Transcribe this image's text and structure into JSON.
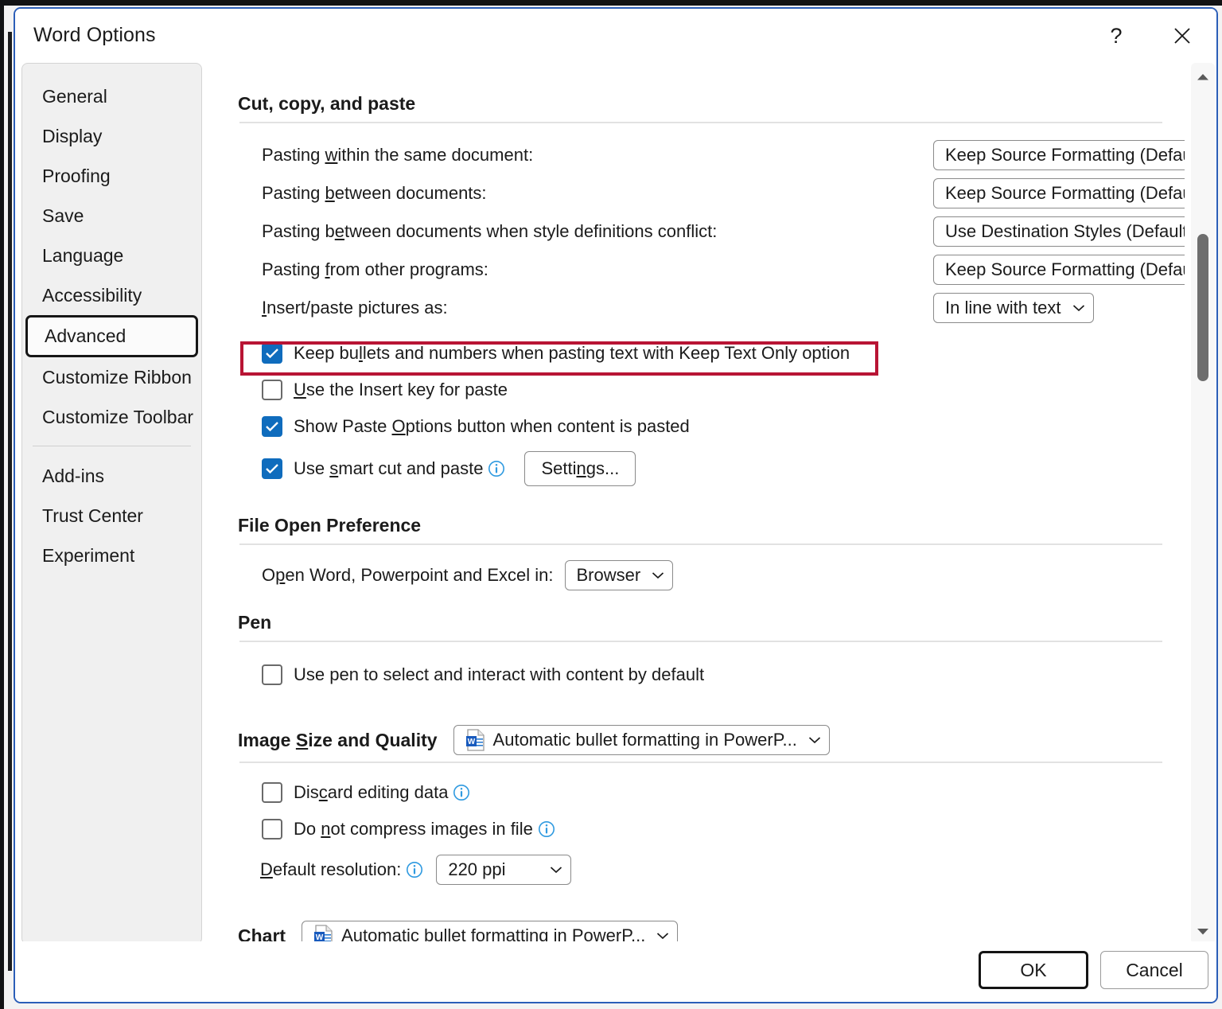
{
  "window": {
    "title": "Word Options",
    "help_icon": "question-mark-icon",
    "close_icon": "close-icon"
  },
  "sidebar": {
    "items": [
      {
        "label": "General",
        "selected": false
      },
      {
        "label": "Display",
        "selected": false
      },
      {
        "label": "Proofing",
        "selected": false
      },
      {
        "label": "Save",
        "selected": false
      },
      {
        "label": "Language",
        "selected": false
      },
      {
        "label": "Accessibility",
        "selected": false
      },
      {
        "label": "Advanced",
        "selected": true
      },
      {
        "label": "Customize Ribbon",
        "selected": false
      },
      {
        "label": "Customize Toolbar",
        "selected": false
      },
      {
        "label": "Add-ins",
        "selected": false
      },
      {
        "label": "Trust Center",
        "selected": false
      },
      {
        "label": "Experiment",
        "selected": false
      }
    ]
  },
  "sections": {
    "cut_copy_paste": {
      "heading": "Cut, copy, and paste",
      "dropdowns": [
        {
          "label_pre": "Pasting ",
          "label_key": "w",
          "label_post": "ithin the same document:",
          "value": "Keep Source Formatting (Default)"
        },
        {
          "label_pre": "Pasting ",
          "label_key": "b",
          "label_post": "etween documents:",
          "value": "Keep Source Formatting (Default)"
        },
        {
          "label_pre": "Pasting b",
          "label_key": "e",
          "label_post": "tween documents when style definitions conflict:",
          "value": "Use Destination Styles (Default)"
        },
        {
          "label_pre": "Pasting ",
          "label_key": "f",
          "label_post": "rom other programs:",
          "value": "Keep Source Formatting (Default)"
        },
        {
          "label_pre": "",
          "label_key": "I",
          "label_post": "nsert/paste pictures as:",
          "value": "In line with text"
        }
      ],
      "checkboxes": [
        {
          "pre": "Keep bu",
          "key": "l",
          "post": "lets and numbers when pasting text with Keep Text Only option",
          "checked": true,
          "info": false,
          "highlighted": true
        },
        {
          "pre": "",
          "key": "U",
          "post": "se the Insert key for paste",
          "checked": false,
          "info": false,
          "highlighted": false
        },
        {
          "pre": "Show Paste ",
          "key": "O",
          "post": "ptions button when content is pasted",
          "checked": true,
          "info": false,
          "highlighted": false
        },
        {
          "pre": "Use ",
          "key": "s",
          "post": "mart cut and paste",
          "checked": true,
          "info": true,
          "highlighted": false
        }
      ],
      "settings_button": {
        "pre": "Setti",
        "key": "n",
        "post": "gs..."
      }
    },
    "file_open_preference": {
      "heading": "File Open Preference",
      "label_pre": "O",
      "label_key": "p",
      "label_post": "en Word, Powerpoint and Excel in:",
      "value": "Browser"
    },
    "pen": {
      "heading": "Pen",
      "checkbox": {
        "pre": "Use pen to select and interact with content by default",
        "key": "",
        "post": "",
        "checked": false
      }
    },
    "image_size_quality": {
      "heading_pre": "Image ",
      "heading_key": "S",
      "heading_post": "ize and Quality",
      "dropdown_value": "Automatic bullet formatting in PowerP...",
      "dropdown_icon": "word-document-icon",
      "checkboxes": [
        {
          "pre": "Dis",
          "key": "c",
          "post": "ard editing data",
          "checked": false,
          "info": true
        },
        {
          "pre": "Do ",
          "key": "n",
          "post": "ot compress images in file",
          "checked": false,
          "info": true
        }
      ],
      "resolution_label_pre": "",
      "resolution_label_key": "D",
      "resolution_label_post": "efault resolution:",
      "resolution_value": "220 ppi"
    },
    "chart": {
      "heading": "Chart",
      "dropdown_value": "Automatic bullet formatting in PowerP...",
      "dropdown_icon": "word-document-icon"
    }
  },
  "scrollbar": {
    "up_icon": "triangle-up-icon",
    "down_icon": "triangle-down-icon"
  },
  "footer": {
    "ok_label": "OK",
    "cancel_label": "Cancel"
  },
  "colors": {
    "accent_blue": "#0f6cbd",
    "window_border": "#2b5eb8",
    "highlight_red": "#b81434",
    "sidebar_bg": "#f0f0f0"
  }
}
